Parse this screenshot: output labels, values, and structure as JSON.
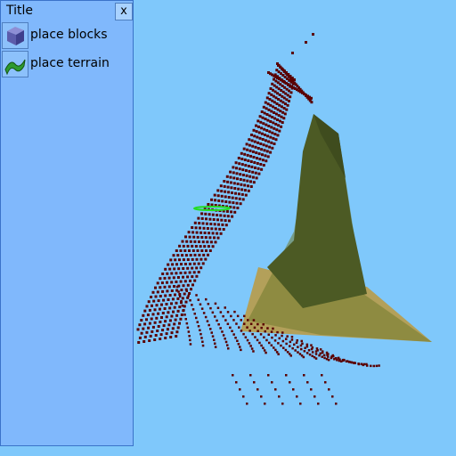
{
  "panel": {
    "title": "Title",
    "close_label": "x",
    "tools": [
      {
        "label": "place blocks",
        "icon": "block-icon"
      },
      {
        "label": "place terrain",
        "icon": "terrain-icon"
      }
    ]
  },
  "scene": {
    "sky_color": "#7fc8fb",
    "point_color": "#5a0000",
    "terrain_color": "#6a6a2a",
    "cursor_color": "#22dd22"
  }
}
